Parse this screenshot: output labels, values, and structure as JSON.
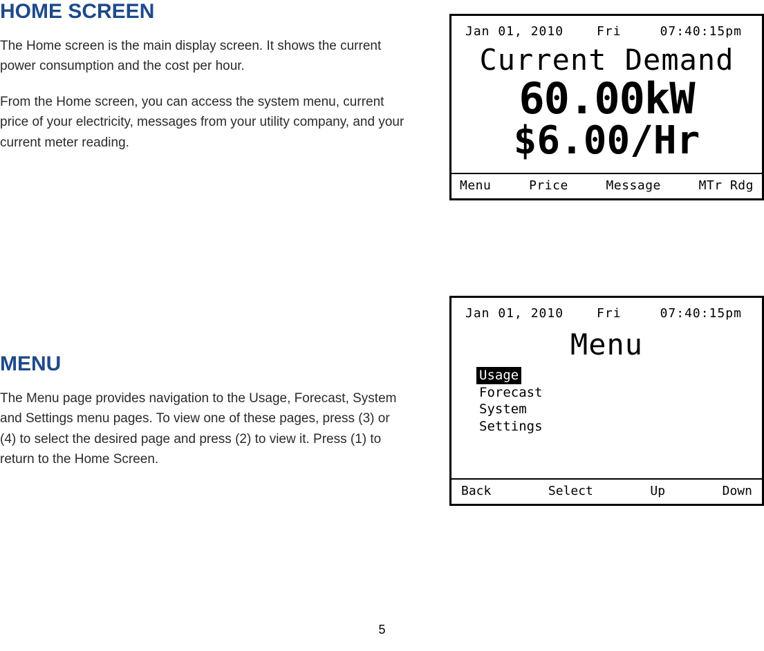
{
  "section1": {
    "heading": "HOME SCREEN",
    "para1": "The Home screen is the main display screen. It shows the current power consumption and the cost per hour.",
    "para2": "From the Home screen, you can access the system menu, current price of your electricity, messages from your utility company, and your current meter reading."
  },
  "screen1": {
    "date": "Jan 01, 2010",
    "dow": "Fri",
    "time": "07:40:15pm",
    "title": "Current Demand",
    "value1": "60.00kW",
    "value2": "$6.00/Hr",
    "softkeys": [
      "Menu",
      "Price",
      "Message",
      "MTr Rdg"
    ]
  },
  "section2": {
    "heading": "MENU",
    "para1": "The Menu page provides navigation to the Usage, Forecast, System and Settings menu pages.  To view one of these pages, press (3) or (4) to select the desired page and press (2) to view it.  Press (1) to return to the Home Screen."
  },
  "screen2": {
    "date": "Jan 01, 2010",
    "dow": "Fri",
    "time": "07:40:15pm",
    "title": "Menu",
    "items": [
      "Usage",
      "Forecast",
      "System",
      "Settings"
    ],
    "selected_index": 0,
    "softkeys": [
      "Back",
      "Select",
      "Up",
      "Down"
    ]
  },
  "page_number": "5"
}
